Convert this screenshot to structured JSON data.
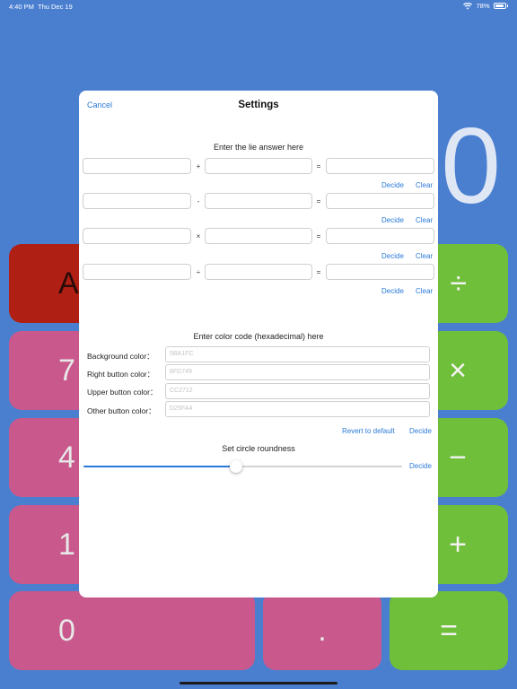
{
  "status_bar": {
    "time": "4:40 PM",
    "date": "Thu Dec 19",
    "battery": "78%"
  },
  "calculator": {
    "display": "0",
    "keys": {
      "ac": "AC",
      "divide": "÷",
      "seven": "7",
      "multiply": "×",
      "four": "4",
      "minus": "−",
      "one": "1",
      "plus": "+",
      "zero": "0",
      "dot": ".",
      "equals": "="
    }
  },
  "settings": {
    "title": "Settings",
    "cancel": "Cancel",
    "lie_section_label": "Enter the lie answer here",
    "operators": [
      "+",
      "-",
      "×",
      "÷"
    ],
    "equals": "=",
    "decide": "Decide",
    "clear": "Clear",
    "color_section_label": "Enter color code (hexadecimal) here",
    "colors": [
      {
        "label": "Background color：",
        "placeholder": "5BA1FC"
      },
      {
        "label": "Right button color：",
        "placeholder": "8FD749"
      },
      {
        "label": "Upper button color：",
        "placeholder": "CC2712"
      },
      {
        "label": "Other button color：",
        "placeholder": "D25FA4"
      }
    ],
    "revert": "Revert to default",
    "roundness_label": "Set circle roundness",
    "roundness_value": 0.48
  },
  "colors": {
    "accent": "#2A79D8",
    "background": "#4A7FD0",
    "red_key": "#B01F13",
    "pink_key": "#C9588C",
    "green_key": "#6FBF3A"
  }
}
